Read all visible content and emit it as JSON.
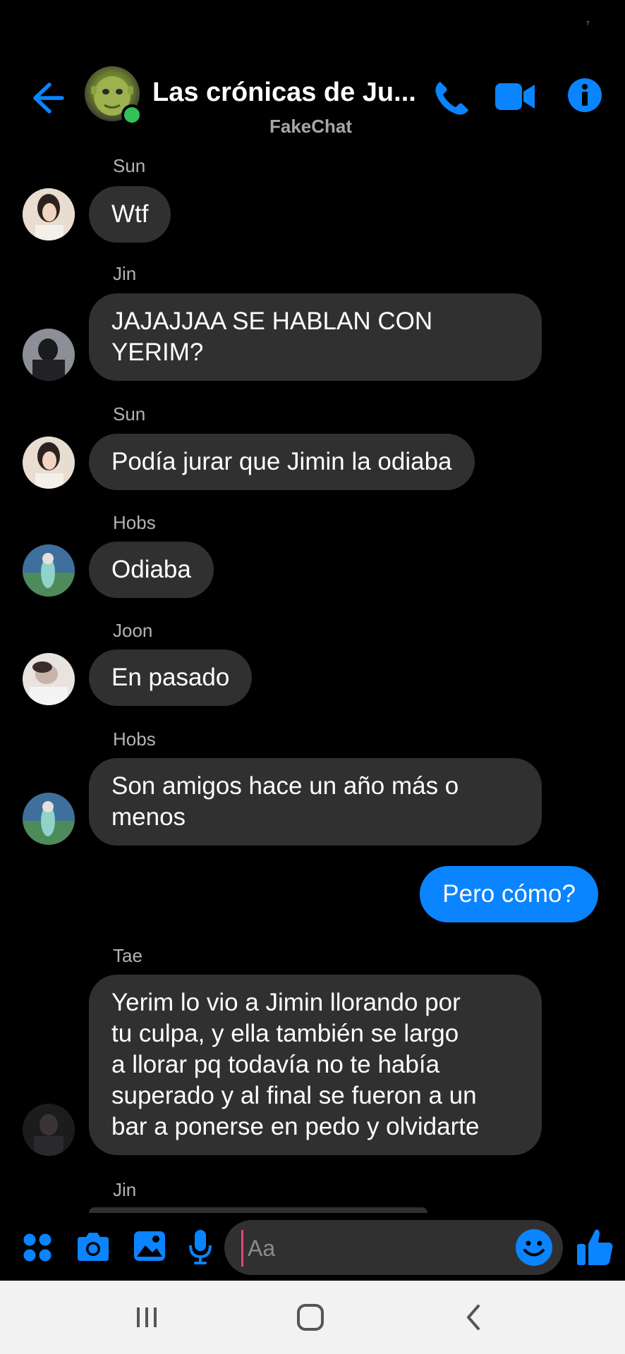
{
  "status": {
    "indicator": "⁷"
  },
  "header": {
    "title": "Las crónicas de Ju...",
    "subtitle": "FakeChat",
    "colors": {
      "accent": "#0a84ff",
      "online": "#31c25a"
    }
  },
  "messages": [
    {
      "sender": "Sun",
      "lines": [
        "Wtf"
      ]
    },
    {
      "sender": "Jin",
      "lines": [
        "JAJAJJAA SE HABLAN CON",
        "YERIM?"
      ]
    },
    {
      "sender": "Sun",
      "lines": [
        "Podía jurar que Jimin la odiaba"
      ]
    },
    {
      "sender": "Hobs",
      "lines": [
        "Odiaba"
      ]
    },
    {
      "sender": "Joon",
      "lines": [
        "En pasado"
      ]
    },
    {
      "sender": "Hobs",
      "lines": [
        "Son amigos hace un año más o",
        "menos"
      ]
    },
    {
      "sender": "",
      "lines": [
        "Pero cómo?"
      ]
    },
    {
      "sender": "Tae",
      "lines": [
        "Yerim lo vio a Jimin llorando por",
        "tu culpa, y ella también se largo",
        "a llorar pq todavía no te había",
        "superado y al final se fueron a un",
        "bar a ponerse en pedo y olvidarte"
      ]
    },
    {
      "sender": "Jin",
      "lines": []
    }
  ],
  "composer": {
    "placeholder": "Aa"
  },
  "icons": {
    "back": "arrow-left-icon",
    "phone": "phone-icon",
    "video": "video-camera-icon",
    "info": "info-icon",
    "apps": "apps-grid-icon",
    "camera": "camera-icon",
    "gallery": "image-icon",
    "mic": "microphone-icon",
    "emoji": "emoji-icon",
    "like": "thumbs-up-icon"
  }
}
